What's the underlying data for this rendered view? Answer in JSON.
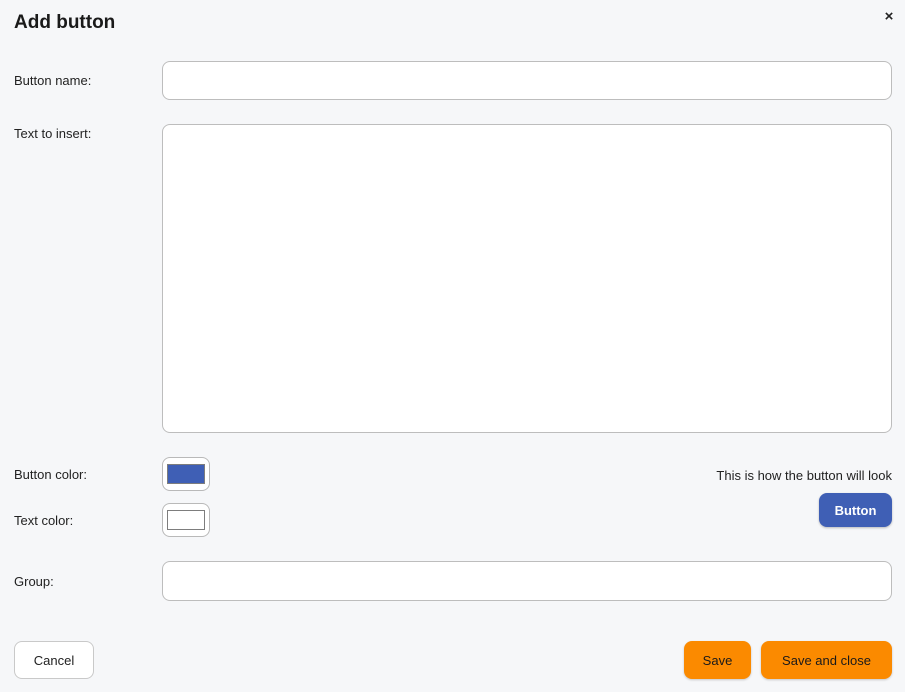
{
  "dialog": {
    "title": "Add button",
    "close_icon": "×"
  },
  "form": {
    "button_name_label": "Button name:",
    "button_name_value": "",
    "text_to_insert_label": "Text to insert:",
    "text_to_insert_value": "",
    "button_color_label": "Button color:",
    "button_color": "#3f5fb5",
    "text_color_label": "Text color:",
    "text_color": "#ffffff",
    "group_label": "Group:",
    "group_value": ""
  },
  "preview": {
    "caption": "This is how the button will look",
    "button_label": "Button"
  },
  "footer": {
    "cancel_label": "Cancel",
    "save_label": "Save",
    "save_close_label": "Save and close"
  },
  "colors": {
    "accent_orange": "#fb8a00",
    "background": "#f6f7f9"
  }
}
